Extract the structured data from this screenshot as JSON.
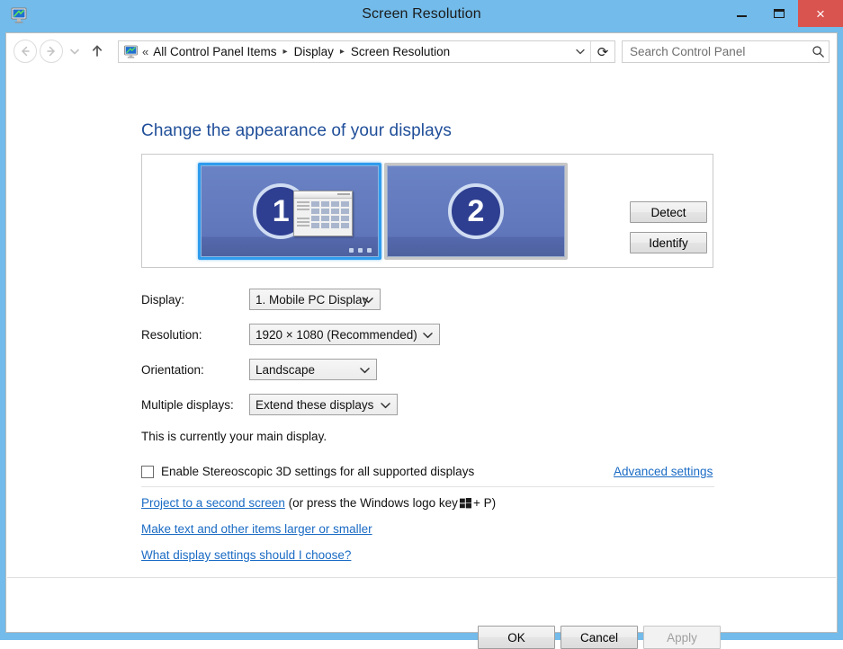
{
  "window": {
    "title": "Screen Resolution",
    "icon": "display-settings-icon",
    "controls": {
      "minimize": "minimize-icon",
      "maximize": "maximize-icon",
      "close": "close-icon",
      "close_glyph": "×"
    }
  },
  "navbar": {
    "back": "back-arrow-icon",
    "forward": "forward-arrow-icon",
    "recent_pages": "chevron-down-icon",
    "up": "up-arrow-icon",
    "address_icon": "control-panel-icon",
    "breadcrumb_overflow": "«",
    "breadcrumbs": [
      "All Control Panel Items",
      "Display",
      "Screen Resolution"
    ],
    "breadcrumb_separator": "▸",
    "address_dropdown": "chevron-down-icon",
    "refresh": "refresh-icon",
    "refresh_glyph": "⟳",
    "search_placeholder": "Search Control Panel",
    "search_value": "",
    "search_icon": "magnifier-icon"
  },
  "main": {
    "page_title": "Change the appearance of your displays",
    "displays": [
      {
        "number": "1",
        "selected": true
      },
      {
        "number": "2",
        "selected": false
      }
    ],
    "detect_label": "Detect",
    "identify_label": "Identify",
    "fields": [
      {
        "label": "Display:",
        "value": "1. Mobile PC Display"
      },
      {
        "label": "Resolution:",
        "value": "1920 × 1080 (Recommended)"
      },
      {
        "label": "Orientation:",
        "value": "Landscape"
      },
      {
        "label": "Multiple displays:",
        "value": "Extend these displays"
      }
    ],
    "main_display_note": "This is currently your main display.",
    "stereoscopic_checkbox": {
      "label": "Enable Stereoscopic 3D settings for all supported displays",
      "checked": false
    },
    "advanced_settings_link": "Advanced settings",
    "links": {
      "project_prefix": "Project to a second screen",
      "project_suffix_a": "(or press the Windows logo key",
      "project_suffix_b": "+ P)",
      "make_text": "Make text and other items larger or smaller",
      "what_settings": "What display settings should I choose?"
    }
  },
  "footer": {
    "ok_label": "OK",
    "cancel_label": "Cancel",
    "apply_label": "Apply",
    "apply_disabled": true
  },
  "colors": {
    "titlebar": "#72bbea",
    "close_button": "#d9534f",
    "heading": "#1f4e99",
    "link": "#1a6bc4",
    "selection_border": "#2f9ced",
    "monitor_face": "#6076bb",
    "badge": "#2e3f91"
  }
}
